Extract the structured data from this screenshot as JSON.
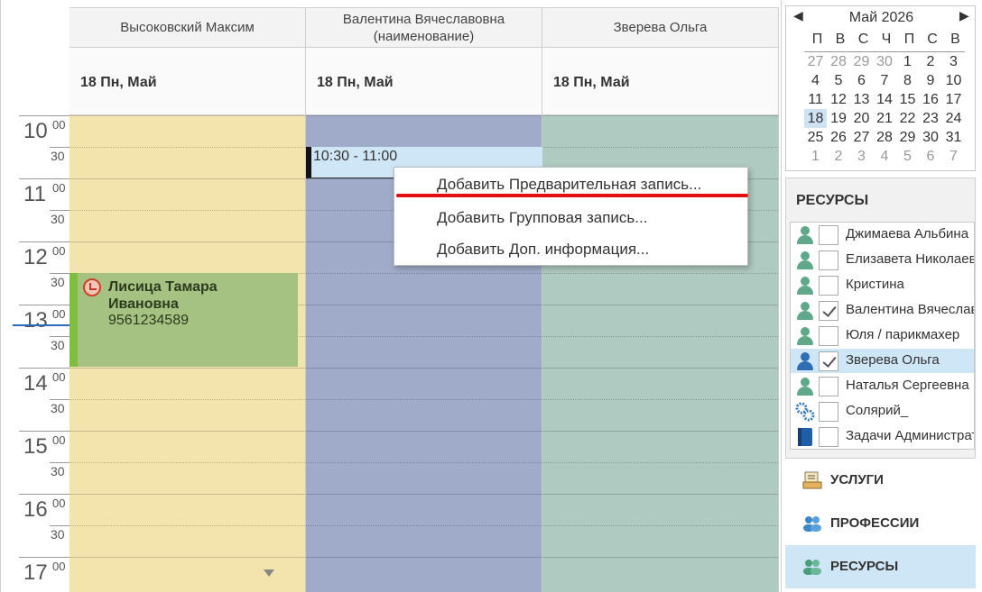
{
  "scheduler": {
    "columns": [
      {
        "header": "Высоковский Максим",
        "date": "18 Пн, Май",
        "color": "#f3e3ac"
      },
      {
        "header_line1": "Валентина Вячеславовна",
        "header_line2": "(наименование)",
        "date": "18 Пн, Май",
        "color": "#9fabc9"
      },
      {
        "header": "Зверева Ольга",
        "date": "18 Пн, Май",
        "color": "#afcac0"
      }
    ],
    "time_minutes_00": "00",
    "time_minutes_30": "30",
    "hours": [
      "10",
      "11",
      "12",
      "13",
      "14",
      "15",
      "16",
      "17"
    ],
    "selected_slot": {
      "label": "10:30 - 11:00"
    },
    "appointment": {
      "name": "Лисица Тамара Ивановна",
      "phone": "9561234589",
      "color": "#a5c283"
    }
  },
  "context_menu": {
    "items": [
      "Добавить Предварительная запись...",
      "Добавить Групповая запись...",
      "Добавить Доп. информация..."
    ],
    "highlight_color": "#e01010"
  },
  "calendar": {
    "month": "Май 2026",
    "prev": "◀",
    "next": "▶",
    "weekdays": [
      "П",
      "В",
      "С",
      "Ч",
      "П",
      "С",
      "В"
    ],
    "weeks": [
      [
        "27",
        "28",
        "29",
        "30",
        "1",
        "2",
        "3"
      ],
      [
        "4",
        "5",
        "6",
        "7",
        "8",
        "9",
        "10"
      ],
      [
        "11",
        "12",
        "13",
        "14",
        "15",
        "16",
        "17"
      ],
      [
        "18",
        "19",
        "20",
        "21",
        "22",
        "23",
        "24"
      ],
      [
        "25",
        "26",
        "27",
        "28",
        "29",
        "30",
        "31"
      ],
      [
        "1",
        "2",
        "3",
        "4",
        "5",
        "6",
        "7"
      ]
    ],
    "today": "18"
  },
  "resources": {
    "title": "РЕСУРСЫ",
    "items": [
      {
        "label": "Джимаева Альбина",
        "icon": "person-icon",
        "checked": false
      },
      {
        "label": "Елизавета Николаевна",
        "icon": "person-icon",
        "checked": false
      },
      {
        "label": "Кристина",
        "icon": "person-icon",
        "checked": false
      },
      {
        "label": "Валентина Вячеславовна",
        "icon": "person-icon",
        "checked": true
      },
      {
        "label": "Юля / парикмахер",
        "icon": "person-icon",
        "checked": false
      },
      {
        "label": "Зверева Ольга",
        "icon": "person-icon-blue",
        "checked": true
      },
      {
        "label": "Наталья Сергеевна",
        "icon": "person-icon",
        "checked": false
      },
      {
        "label": "Солярий_",
        "icon": "gears-icon",
        "checked": false
      },
      {
        "label": "Задачи Администратора",
        "icon": "book-icon",
        "checked": false
      }
    ]
  },
  "nav_buttons": [
    {
      "label": "УСЛУГИ",
      "icon": "services-icon"
    },
    {
      "label": "ПРОФЕССИИ",
      "icon": "professions-icon"
    },
    {
      "label": "РЕСУРСЫ",
      "icon": "resources-icon"
    }
  ]
}
